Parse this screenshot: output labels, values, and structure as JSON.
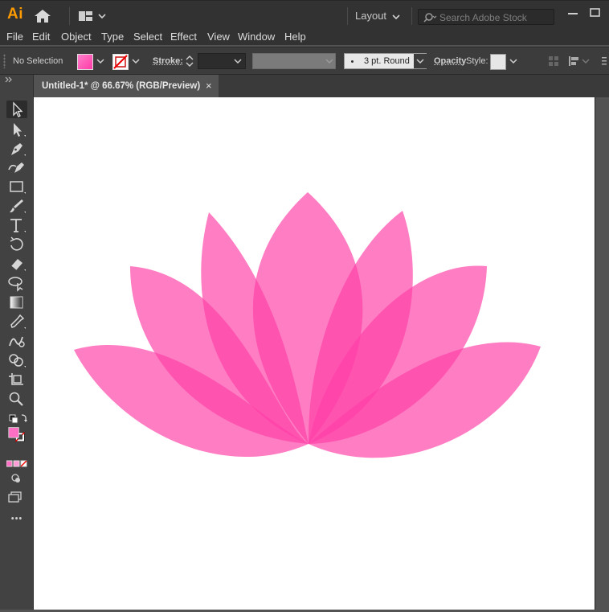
{
  "app": {
    "logo": "Ai",
    "workspace": "Layout",
    "colors": {
      "accent": "#ff9a00",
      "petal": "#ff3fa6",
      "panel": "#424242",
      "chrome": "#323232"
    }
  },
  "search": {
    "placeholder": "Search Adobe Stock"
  },
  "menu": {
    "items": [
      "File",
      "Edit",
      "Object",
      "Type",
      "Select",
      "Effect",
      "View",
      "Window",
      "Help"
    ]
  },
  "control_bar": {
    "selection": "No Selection",
    "stroke_label": "Stroke:",
    "brush": "3 pt. Round",
    "opacity_label": "Opacity",
    "style_label": "Style:"
  },
  "document": {
    "tab_title": "Untitled-1* @ 66.67% (RGB/Preview)",
    "close_glyph": "×"
  },
  "tools": [
    "selection-tool",
    "direct-selection-tool",
    "pen-tool",
    "curvature-tool",
    "rectangle-tool",
    "paintbrush-tool",
    "type-tool",
    "rotate-tool",
    "eraser-tool",
    "lasso-tool",
    "gradient-tool",
    "eyedropper-tool",
    "blend-tool",
    "shape-builder-tool",
    "artboard-tool",
    "zoom-tool",
    "default-colors",
    "fill-stroke",
    "color-modes",
    "draw-mode",
    "screen-mode",
    "edit-toolbar"
  ],
  "toolbar_more": "•••"
}
